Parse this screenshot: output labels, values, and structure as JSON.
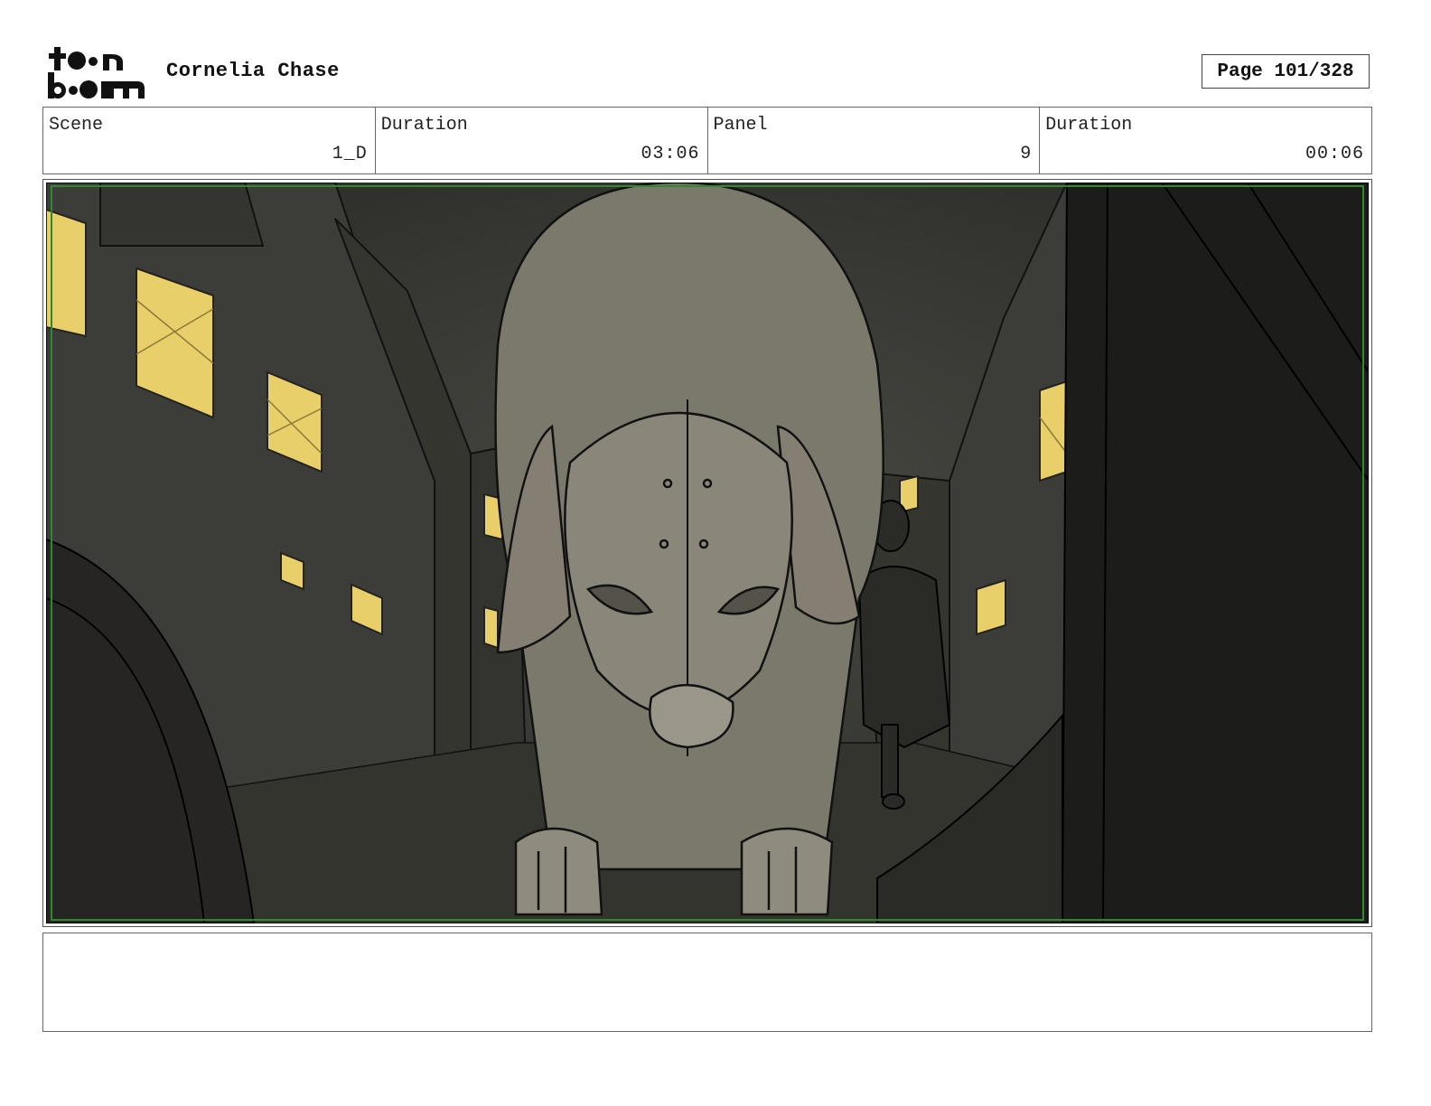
{
  "header": {
    "brand": "toon boom",
    "project_title": "Cornelia Chase",
    "page_label": "Page 101/328"
  },
  "info": {
    "scene_label": "Scene",
    "scene_value": "1_D",
    "scene_duration_label": "Duration",
    "scene_duration_value": "03:06",
    "panel_label": "Panel",
    "panel_value": "9",
    "panel_duration_label": "Duration",
    "panel_duration_value": "00:06"
  },
  "panel_image": {
    "subject": "storyboard-drawing"
  },
  "colors": {
    "window_light": "#e9cf6a",
    "night_wall": "#3a3a36",
    "safe_area": "#2f8a2f"
  },
  "notes": {
    "text": ""
  }
}
